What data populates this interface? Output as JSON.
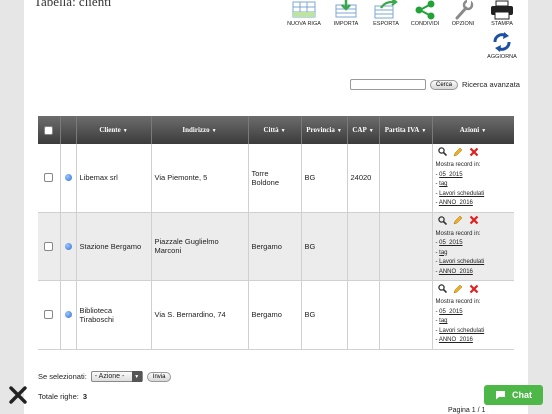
{
  "page": {
    "title": "Tabella: clienti"
  },
  "toolbar": {
    "new_row": "NUOVA RIGA",
    "import": "IMPORTA",
    "export": "ESPORTA",
    "share": "CONDIVIDI",
    "options": "OPZIONI",
    "print": "STAMPA",
    "refresh": "AGGIORNA"
  },
  "search": {
    "value": "",
    "button": "Cerca",
    "advanced": "Ricerca avanzata"
  },
  "table": {
    "headers": {
      "cliente": "Cliente",
      "indirizzo": "Indirizzo",
      "citta": "Città",
      "provincia": "Provincia",
      "cap": "CAP",
      "partita_iva": "Partita IVA",
      "azioni": "Azioni"
    },
    "rows": [
      {
        "cliente": "Libemax srl",
        "indirizzo": "Via Piemonte, 5",
        "citta": "Torre Boldone",
        "provincia": "BG",
        "cap": "24020",
        "partita_iva": ""
      },
      {
        "cliente": "Stazione Bergamo",
        "indirizzo": "Piazzale Guglielmo Marconi",
        "citta": "Bergamo",
        "provincia": "BG",
        "cap": "",
        "partita_iva": ""
      },
      {
        "cliente": "Biblioteca Tiraboschi",
        "indirizzo": "Via S. Bernardino, 74",
        "citta": "Bergamo",
        "provincia": "BG",
        "cap": "",
        "partita_iva": ""
      }
    ],
    "actions": {
      "show_records": "Mostra record in:",
      "link_1": "05_2015",
      "link_2": "tag",
      "link_3": "Lavori schedulati",
      "link_4": "ANNO_2016"
    }
  },
  "bulk": {
    "label": "Se selezionati:",
    "selected": "- Azione -",
    "button": "Invia"
  },
  "total": {
    "label": "Totale righe:",
    "value": "3"
  },
  "pager": {
    "label": "Pagina",
    "current": "1",
    "of": "/ 1"
  },
  "chat": {
    "label": "Chat"
  },
  "colors": {
    "header_dark": "#3b3b3b",
    "chat_green": "#4db848",
    "delete_red": "#e02020"
  }
}
